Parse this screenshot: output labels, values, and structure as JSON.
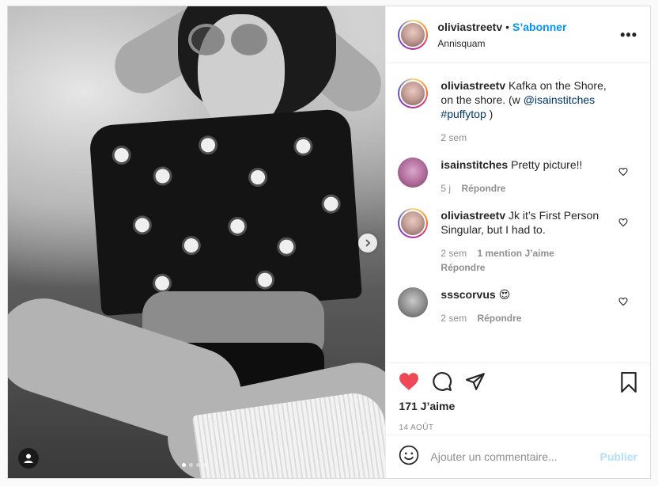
{
  "post": {
    "username": "oliviastreetv",
    "separator": "•",
    "follow_label": "S’abonner",
    "location": "Annisquam",
    "more_label": "•••"
  },
  "caption": {
    "username": "oliviastreetv",
    "text": "Kafka on the Shore, on the shore. (w",
    "mention": "@isainstitches",
    "hashtag": "#puffytop",
    "close": ")",
    "time": "2 sem"
  },
  "comments": [
    {
      "username": "isainstitches",
      "text": "Pretty picture!!",
      "time": "5 j",
      "likes": "",
      "reply": "Répondre"
    },
    {
      "username": "oliviastreetv",
      "text": "Jk it’s First Person Singular, but I had to.",
      "time": "2 sem",
      "likes": "1 mention J’aime",
      "reply": "Répondre"
    },
    {
      "username": "ssscorvus",
      "text": "😍",
      "time": "2 sem",
      "likes": "",
      "reply": "Répondre"
    }
  ],
  "stats": {
    "likes": "171 J’aime",
    "date": "14 AOÛT"
  },
  "composer": {
    "placeholder": "Ajouter un commentaire...",
    "publish_label": "Publier"
  },
  "colors": {
    "accent": "#0095f6",
    "like_red": "#ed4956",
    "publish_disabled": "#b2dffc"
  },
  "icons": [
    "heart-icon",
    "comment-icon",
    "share-icon",
    "bookmark-icon",
    "emoji-icon",
    "user-tag-icon",
    "chevron-right-icon"
  ]
}
